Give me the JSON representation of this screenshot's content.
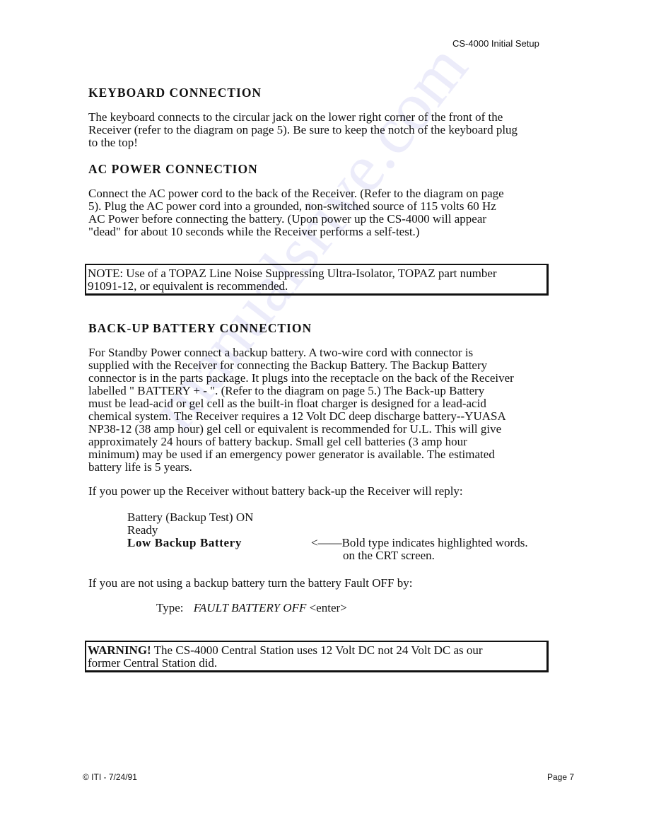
{
  "header": {
    "running_title": "CS-4000 Initial Setup"
  },
  "sections": {
    "keyboard": {
      "heading": "KEYBOARD  CONNECTION",
      "lines": [
        "The keyboard connects to the circular jack on the lower right corner of the front of the",
        "Receiver (refer to the diagram on page 5).  Be sure to keep the notch of the keyboard plug",
        "to the top!"
      ]
    },
    "ac_power": {
      "heading": "AC  POWER  CONNECTION",
      "lines": [
        "Connect the AC power cord to the back of the Receiver.  (Refer to the diagram on page",
        "5).  Plug the AC power cord into a grounded, non-switched source of 115 volts 60 Hz",
        "AC Power before connecting the battery.  (Upon power up the CS-4000 will appear",
        "\"dead\" for about 10 seconds while the Receiver performs a self-test.)"
      ]
    },
    "note_box": {
      "lines": [
        "NOTE: Use of a TOPAZ Line Noise Suppressing Ultra-Isolator, TOPAZ part number",
        "91091-12, or equivalent is recommended."
      ]
    },
    "battery": {
      "heading": "BACK-UP  BATTERY  CONNECTION",
      "lines": [
        "For Standby Power connect a backup battery.  A two-wire cord with connector is",
        "supplied with the Receiver for connecting the Backup Battery.  The Backup Battery",
        "connector is in the parts package. It plugs into the receptacle on the back of the Receiver",
        "labelled \" BATTERY +   - \". (Refer to the diagram on page 5.)  The Back-up Battery",
        "must be lead-acid or gel cell as the built-in float charger is designed for a lead-acid",
        "chemical system.  The Receiver requires a 12 Volt DC deep discharge battery--YUASA",
        "NP38-12 (38 amp hour) gel cell or equivalent is recommended for U.L.  This will give",
        "approximately 24 hours of battery backup.  Small gel cell batteries (3 amp hour",
        "minimum) may be used if an emergency power generator is available.  The estimated",
        "battery life is 5 years."
      ],
      "reply_intro": "If you power up the Receiver without battery back-up the Receiver will reply:",
      "reply_lines": {
        "line1": "Battery (Backup Test) ON",
        "line2": "Ready",
        "line3_bold": "Low  Backup  Battery"
      },
      "annotation": {
        "line1": "<——Bold type indicates highlighted words.",
        "line2": "on the CRT screen."
      },
      "fault_intro": "If you are not using a backup battery turn the battery Fault OFF by:",
      "type_label": "Type:",
      "type_command": "FAULT BATTERY OFF",
      "type_suffix": "<enter>"
    },
    "warning_box": {
      "bold_prefix": "WARNING!",
      "line1_rest": " The CS-4000 Central Station uses 12 Volt DC not 24 Volt DC as our",
      "line2": "former Central Station did."
    }
  },
  "footer": {
    "left": "© ITI - 7/24/91",
    "right": "Page 7"
  },
  "watermark": {
    "text": "manualsrive.com",
    "color": "#c9c9f2"
  }
}
